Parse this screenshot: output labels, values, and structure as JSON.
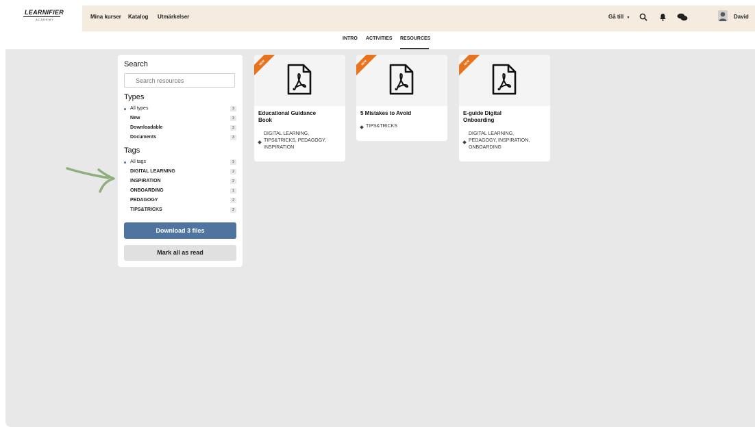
{
  "brand": {
    "logo_text": "LEARNIFIER",
    "logo_sub": "ACADEMY"
  },
  "nav": {
    "items": [
      "Mina kurser",
      "Katalog",
      "Utmärkelser"
    ]
  },
  "header_right": {
    "goto": "Gå till",
    "user": "David"
  },
  "icons": [
    "search-icon",
    "bell-icon",
    "chat-icon",
    "user-avatar-icon"
  ],
  "tabs": [
    "INTRO",
    "ACTIVITIES",
    "RESOURCES"
  ],
  "active_tab": "RESOURCES",
  "sidebar": {
    "search_title": "Search",
    "search_placeholder": "Search resources",
    "types_title": "Types",
    "types": [
      {
        "label": "All types",
        "count": "3"
      },
      {
        "label": "New",
        "count": "3"
      },
      {
        "label": "Downloadable",
        "count": "3"
      },
      {
        "label": "Documents",
        "count": "3"
      }
    ],
    "tags_title": "Tags",
    "tags": [
      {
        "label": "All tags",
        "count": "3"
      },
      {
        "label": "DIGITAL LEARNING",
        "count": "2"
      },
      {
        "label": "INSPIRATION",
        "count": "2"
      },
      {
        "label": "ONBOARDING",
        "count": "1"
      },
      {
        "label": "PEDAGOGY",
        "count": "2"
      },
      {
        "label": "TIPS&TRICKS",
        "count": "2"
      }
    ],
    "download_label": "Download 3 files",
    "mark_read_label": "Mark all as read"
  },
  "cards": [
    {
      "badge": "NEW",
      "title_lines": [
        "Educational Guidance",
        "Book"
      ],
      "tag_lines": [
        "DIGITAL LEARNING,",
        "TIPS&TRICKS, PEDAGOGY,",
        "INSPIRATION"
      ]
    },
    {
      "badge": "NEW",
      "title_lines": [
        "5 Mistakes to Avoid"
      ],
      "tag_lines": [
        "TIPS&TRICKS"
      ]
    },
    {
      "badge": "NEW",
      "title_lines": [
        "E-guide Digital",
        "Onboarding"
      ],
      "tag_lines": [
        "DIGITAL LEARNING,",
        "PEDAGOGY, INSPIRATION,",
        "ONBOARDING"
      ]
    }
  ],
  "colors": {
    "accent": "#4e749f",
    "ribbon": "#e8731e",
    "header_bg": "#f6ebdf",
    "page_bg": "#e8e8e8",
    "annotation_arrow": "#8fae7e"
  }
}
